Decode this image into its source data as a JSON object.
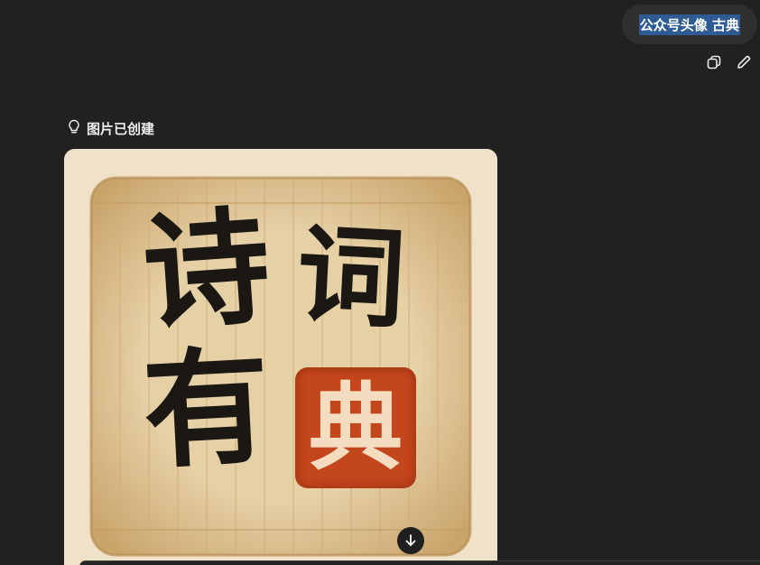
{
  "user_message": {
    "text": "公众号头像 古典"
  },
  "message_actions": {
    "copy_icon": "copy-icon",
    "edit_icon": "edit-icon"
  },
  "status": {
    "icon": "lightbulb-icon",
    "text": "图片已创建"
  },
  "image": {
    "title_chars": [
      "诗",
      "词",
      "有"
    ],
    "seal_char": "典",
    "colors": {
      "paper": "#efe2c8",
      "bamboo": "#e2c89a",
      "ink": "#1b1712",
      "seal": "#c4461c",
      "seal_text": "#f3dcc0"
    },
    "download_icon": "download-icon"
  }
}
